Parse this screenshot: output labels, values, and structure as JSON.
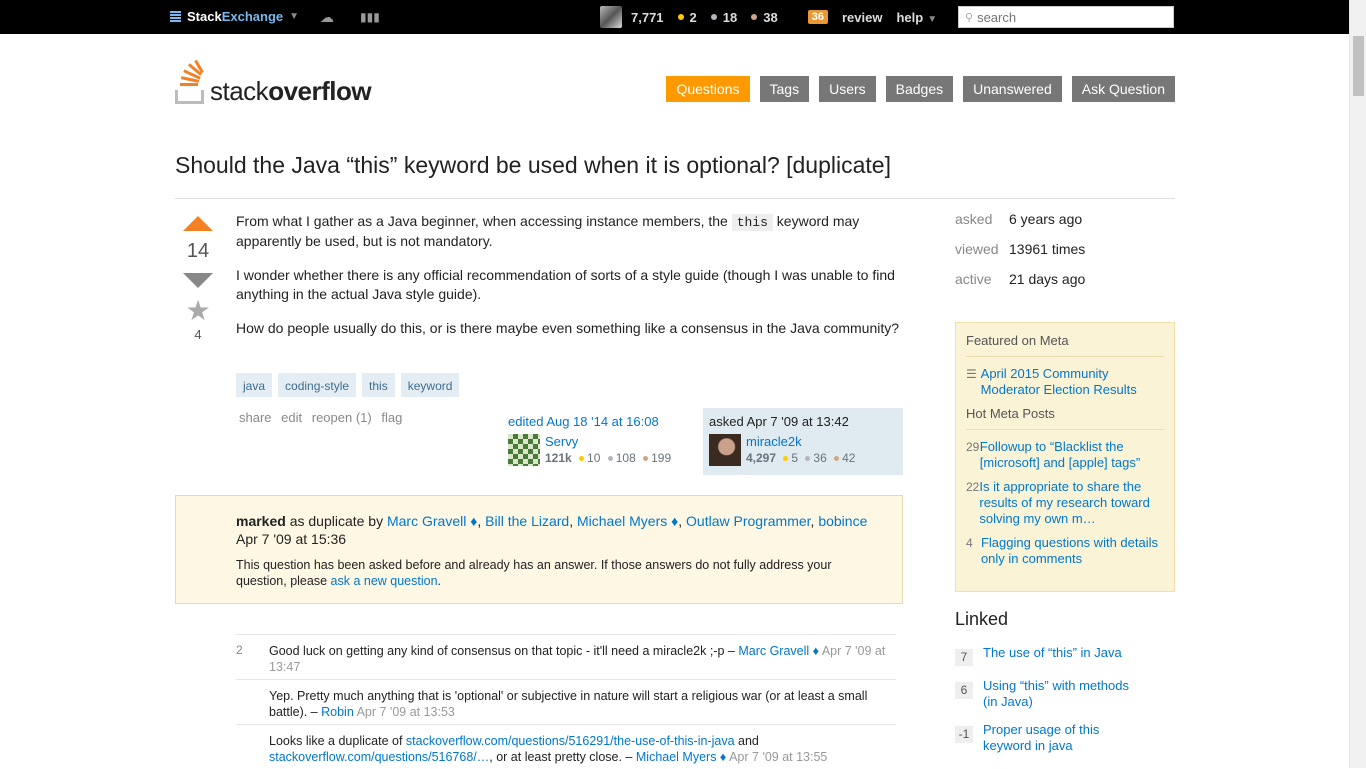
{
  "topbar": {
    "brand_part1": "Stack",
    "brand_part2": "Exchange",
    "reputation": "7,771",
    "gold": "2",
    "silver": "18",
    "bronze": "38",
    "review_badge": "36",
    "review": "review",
    "help": "help",
    "search_placeholder": "search"
  },
  "header": {
    "logo_part1": "stack",
    "logo_part2": "overflow",
    "nav": [
      "Questions",
      "Tags",
      "Users",
      "Badges",
      "Unanswered",
      "Ask Question"
    ]
  },
  "question": {
    "title": "Should the Java “this” keyword be used when it is optional? [duplicate]",
    "votes": "14",
    "favorites": "4",
    "p1_before": "From what I gather as a Java beginner, when accessing instance members, the ",
    "p1_code": "this",
    "p1_after": " keyword may apparently be used, but is not mandatory.",
    "p2": "I wonder whether there is any official recommendation of sorts of a style guide (though I was unable to find anything in the actual Java style guide).",
    "p3": "How do people usually do this, or is there maybe even something like a consensus in the Java community?",
    "tags": [
      "java",
      "coding-style",
      "this",
      "keyword"
    ],
    "menu": [
      "share",
      "edit",
      "reopen (1)",
      "flag"
    ],
    "editor": {
      "action": "edited Aug 18 '14 at 16:08",
      "name": "Servy",
      "rep": "121k",
      "gold": "10",
      "silver": "108",
      "bronze": "199"
    },
    "owner": {
      "action": "asked Apr 7 '09 at 13:42",
      "name": "miracle2k",
      "rep": "4,297",
      "gold": "5",
      "silver": "36",
      "bronze": "42"
    }
  },
  "duplicate": {
    "marked": "marked",
    "as_dup_by": " as duplicate by ",
    "users": [
      "Marc Gravell ♦",
      "Bill the Lizard",
      "Michael Myers ♦",
      "Outlaw Programmer",
      "bobince"
    ],
    "date": " Apr 7 '09 at 15:36",
    "notice_before": "This question has been asked before and already has an answer. If those answers do not fully address your question, please ",
    "notice_link": "ask a new question",
    "notice_after": "."
  },
  "comments": [
    {
      "score": "2",
      "text": "Good luck on getting any kind of consensus on that topic - it'll need a miracle2k ;-p – ",
      "user": "Marc Gravell ♦",
      "date": " Apr 7 '09 at 13:47"
    },
    {
      "score": "",
      "text": "Yep. Pretty much anything that is 'optional' or subjective in nature will start a religious war (or at least a small battle). – ",
      "user": "Robin",
      "date": " Apr 7 '09 at 13:53"
    },
    {
      "score": "",
      "text_before": "Looks like a duplicate of ",
      "link1": "stackoverflow.com/questions/516291/the-use-of-this-in-java",
      "text_mid": " and ",
      "link2": "stackoverflow.com/questions/516768/…",
      "text_after": ", or at least pretty close. – ",
      "user": "Michael Myers ♦",
      "date": " Apr 7 '09 at 13:55"
    }
  ],
  "sidebar": {
    "stats": [
      {
        "label": "asked",
        "value": "6 years ago"
      },
      {
        "label": "viewed",
        "value": "13961 times"
      },
      {
        "label": "active",
        "value": "21 days ago"
      }
    ],
    "featured_heading": "Featured on Meta",
    "featured": [
      "April 2015 Community Moderator Election Results"
    ],
    "hot_heading": "Hot Meta Posts",
    "hot": [
      {
        "count": "29",
        "title": "Followup to “Blacklist the [microsoft] and [apple] tags”"
      },
      {
        "count": "22",
        "title": "Is it appropriate to share the results of my research toward solving my own m…"
      },
      {
        "count": "4",
        "title": "Flagging questions with details only in comments"
      }
    ],
    "linked_heading": "Linked",
    "linked": [
      {
        "count": "7",
        "title": "The use of “this” in Java"
      },
      {
        "count": "6",
        "title": "Using “this” with methods (in Java)"
      },
      {
        "count": "-1",
        "title": "Proper usage of this keyword in java"
      }
    ]
  },
  "colors": {
    "accent": "#f48024",
    "link": "#0077cc",
    "nav_active": "#ff9900"
  }
}
